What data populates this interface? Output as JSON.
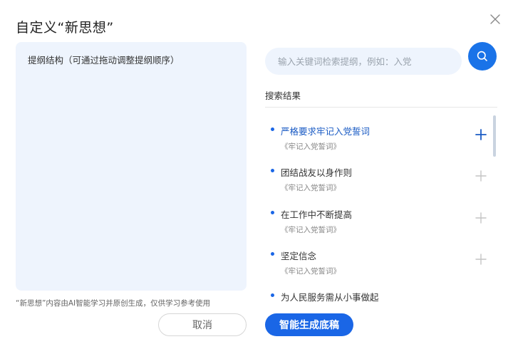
{
  "dialog": {
    "title": "自定义“新思想”",
    "close_icon": "close-icon"
  },
  "outline": {
    "label": "提纲结构（可通过拖动调整提纲顺序）"
  },
  "disclaimer": "“新思想”内容由AI智能学习并原创生成，仅供学习参考使用",
  "search": {
    "placeholder": "输入关键词检索提纲，例如：入党",
    "icon": "search-icon"
  },
  "results": {
    "header": "搜索结果",
    "items": [
      {
        "title": "严格要求牢记入党誓词",
        "source": "《牢记入党誓词》",
        "active": true
      },
      {
        "title": "团结战友以身作则",
        "source": "《牢记入党誓词》",
        "active": false
      },
      {
        "title": "在工作中不断提高",
        "source": "《牢记入党誓词》",
        "active": false
      },
      {
        "title": "坚定信念",
        "source": "《牢记入党誓词》",
        "active": false
      },
      {
        "title": "为人民服务需从小事做起",
        "source": "",
        "active": false
      }
    ]
  },
  "buttons": {
    "cancel": "取消",
    "generate": "智能生成底稿"
  },
  "colors": {
    "accent": "#1a66e6",
    "panel_bg": "#eef4fd",
    "active_text": "#1a5bc4"
  }
}
